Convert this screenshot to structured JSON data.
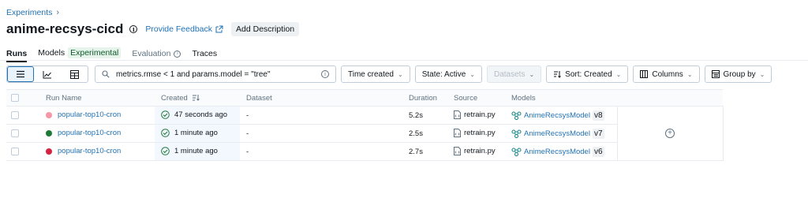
{
  "breadcrumb": {
    "parent": "Experiments",
    "separator": "›"
  },
  "header": {
    "title": "anime-recsys-cicd",
    "feedback_label": "Provide Feedback",
    "add_description_label": "Add Description"
  },
  "tabs": [
    {
      "label": "Runs",
      "active": true
    },
    {
      "label": "Models",
      "badge": "Experimental"
    },
    {
      "label": "Evaluation"
    },
    {
      "label": "Traces"
    }
  ],
  "toolbar": {
    "search_value": "metrics.rmse < 1 and params.model = \"tree\"",
    "time_created_label": "Time created",
    "state_label": "State: Active",
    "datasets_label": "Datasets",
    "sort_label": "Sort: Created",
    "columns_label": "Columns",
    "group_by_label": "Group by"
  },
  "table": {
    "headers": {
      "run_name": "Run Name",
      "created": "Created",
      "dataset": "Dataset",
      "duration": "Duration",
      "source": "Source",
      "models": "Models"
    },
    "rows": [
      {
        "color": "#f497a7",
        "run_name": "popular-top10-cron",
        "created": "47 seconds ago",
        "dataset": "-",
        "duration": "5.2s",
        "source": "retrain.py",
        "model": "AnimeRecsysModel",
        "version": "v8"
      },
      {
        "color": "#1d7a36",
        "run_name": "popular-top10-cron",
        "created": "1 minute ago",
        "dataset": "-",
        "duration": "2.5s",
        "source": "retrain.py",
        "model": "AnimeRecsysModel",
        "version": "v7"
      },
      {
        "color": "#d32440",
        "run_name": "popular-top10-cron",
        "created": "1 minute ago",
        "dataset": "-",
        "duration": "2.7s",
        "source": "retrain.py",
        "model": "AnimeRecsysModel",
        "version": "v6"
      }
    ]
  },
  "colors": {
    "link": "#2272b4",
    "accent_bg": "#e8f3fb",
    "border": "#c0cdd8"
  }
}
